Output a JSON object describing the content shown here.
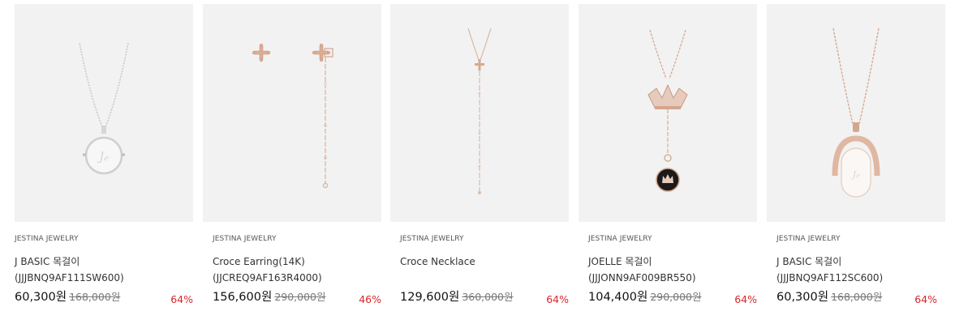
{
  "products": [
    {
      "brand": "JESTINA JEWELRY",
      "name_line1": "J BASIC 목걸이",
      "name_line2": "(JJJBNQ9AF111SW600)",
      "price": "60,300원",
      "original_price": "168,000원",
      "discount": "64%",
      "image_icon": "silver-coin-pendant-necklace"
    },
    {
      "brand": "JESTINA JEWELRY",
      "name_line1": "Croce Earring(14K)",
      "name_line2": "(JJCREQ9AF163R4000)",
      "price": "156,600원",
      "original_price": "290,000원",
      "discount": "46%",
      "image_icon": "cross-drop-earrings"
    },
    {
      "brand": "JESTINA JEWELRY",
      "name_line1": "Croce Necklace",
      "name_line2": "",
      "price": "129,600원",
      "original_price": "360,000원",
      "discount": "64%",
      "image_icon": "cross-lariat-necklace"
    },
    {
      "brand": "JESTINA JEWELRY",
      "name_line1": "JOELLE 목걸이 (JJJONN9AF009BR550)",
      "name_line2": "",
      "price": "104,400원",
      "original_price": "290,000원",
      "discount": "64%",
      "image_icon": "crown-drop-necklace"
    },
    {
      "brand": "JESTINA JEWELRY",
      "name_line1": "J BASIC 목걸이 (JJJBNQ9AF112SC600)",
      "name_line2": "",
      "price": "60,300원",
      "original_price": "168,000원",
      "discount": "64%",
      "image_icon": "rose-gold-coin-pendant-necklace"
    }
  ],
  "colors": {
    "discount": "#d8262a",
    "thumb_bg": "#f2f2f2",
    "rose_gold": "#d9a88f",
    "silver": "#c4c4c4"
  }
}
